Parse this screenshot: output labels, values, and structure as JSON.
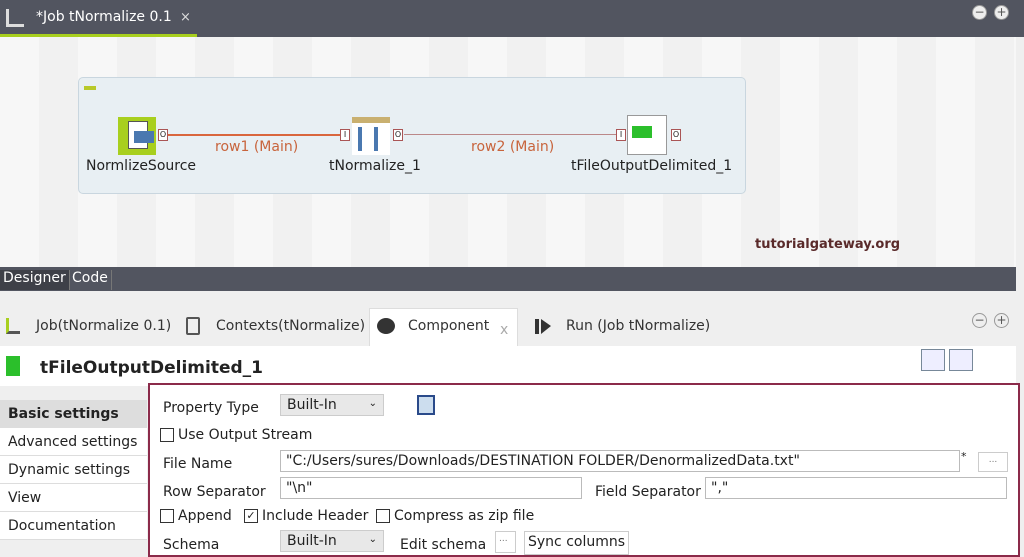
{
  "editor": {
    "tab_title": "*Job tNormalize 0.1",
    "close": "×",
    "minimize": "−",
    "maximize": "+"
  },
  "diagram": {
    "components": [
      {
        "label": "NormlizeSource"
      },
      {
        "label": "tNormalize_1"
      },
      {
        "label": "tFileOutputDelimited_1"
      }
    ],
    "connections": [
      {
        "label": "row1 (Main)"
      },
      {
        "label": "row2 (Main)"
      }
    ],
    "port_out": "O",
    "port_in": "I",
    "watermark": "tutorialgateway.org"
  },
  "designer_tabs": [
    "Designer",
    "Code"
  ],
  "views": {
    "tabs": [
      "Job(tNormalize 0.1)",
      "Contexts(tNormalize)",
      "Component",
      "Run (Job tNormalize)"
    ],
    "close": "x"
  },
  "component": {
    "title": "tFileOutputDelimited_1"
  },
  "sidebar": [
    "Basic settings",
    "Advanced settings",
    "Dynamic settings",
    "View",
    "Documentation"
  ],
  "form": {
    "property_type_label": "Property Type",
    "property_type": "Built-In",
    "use_output_stream": "Use Output Stream",
    "file_name_label": "File Name",
    "file_name": "\"C:/Users/sures/Downloads/DESTINATION FOLDER/DenormalizedData.txt\"",
    "required": "*",
    "browse": "...",
    "row_sep_label": "Row Separator",
    "row_sep": "\"\\n\"",
    "field_sep_label": "Field Separator",
    "field_sep": "\",\"",
    "append": "Append",
    "include_header": "Include Header",
    "compress": "Compress as zip file",
    "check": "✓",
    "dropdown": "⌄",
    "schema_label": "Schema",
    "schema": "Built-In",
    "edit_schema": "Edit schema",
    "edit_btn": "...",
    "sync": "Sync columns"
  },
  "colors": {
    "accent": "#a8cf1e",
    "frame": "#8b2a4a",
    "link": "#d9663d"
  }
}
